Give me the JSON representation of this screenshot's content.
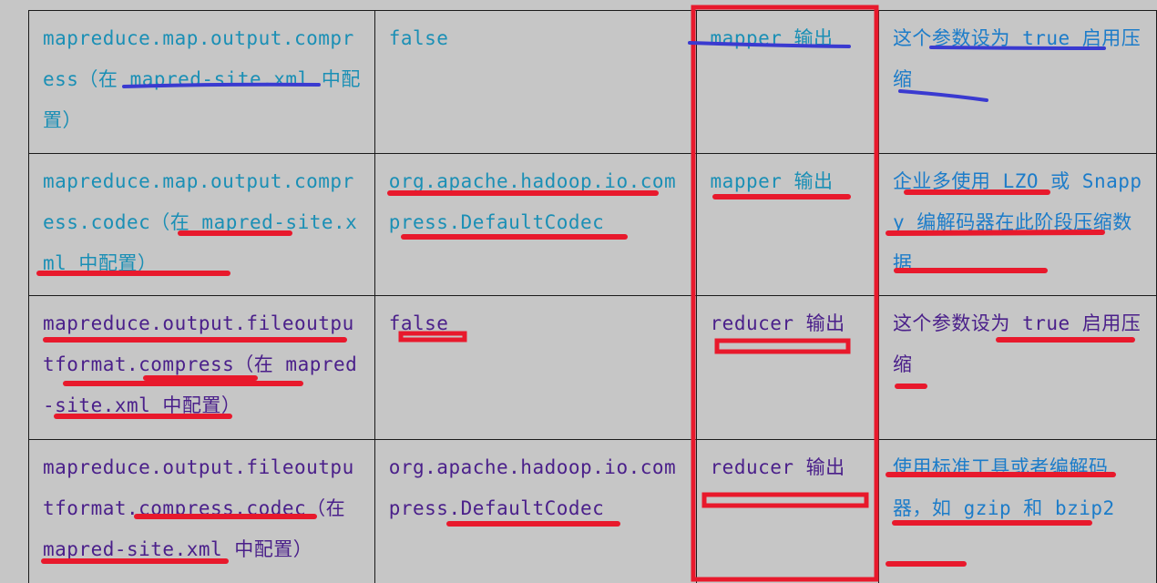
{
  "rows": [
    {
      "param": "mapreduce.map.output.compress（在 mapred-site.xml 中配置）",
      "default": "false",
      "stage": "mapper 输出",
      "advice": "这个参数设为 true 启用压缩"
    },
    {
      "param": "mapreduce.map.output.compress.codec（在 mapred-site.xml 中配置）",
      "default": "org.apache.hadoop.io.compress.DefaultCodec",
      "stage": "mapper 输出",
      "advice": "企业多使用 LZO 或 Snappy 编解码器在此阶段压缩数据"
    },
    {
      "param": "mapreduce.output.fileoutputformat.compress（在 mapred-site.xml 中配置）",
      "default": "false",
      "stage": "reducer 输出",
      "advice": "这个参数设为 true 启用压缩"
    },
    {
      "param": "mapreduce.output.fileoutputformat.compress.codec（在 mapred-site.xml 中配置）",
      "default": "org.apache.hadoop.io.compress.DefaultCodec",
      "stage": "reducer 输出",
      "advice": "使用标准工具或者编解码器，如 gzip 和 bzip2"
    }
  ],
  "colors": {
    "param_text_rows_1_2": "#1a8fb5",
    "param_text_rows_3_4": "#4a1f8a",
    "advice_text": "#1c7cc9",
    "annotation_red": "#e8192c",
    "annotation_blue": "#3a3ad0"
  }
}
